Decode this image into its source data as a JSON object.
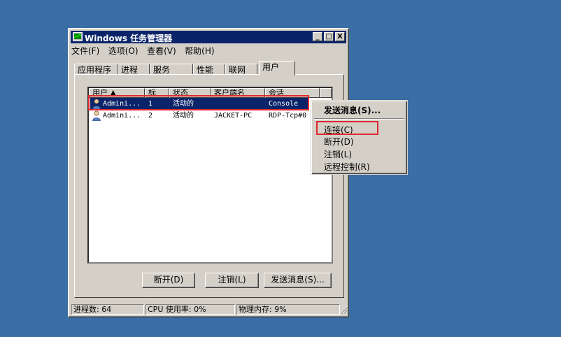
{
  "window": {
    "title": "Windows 任务管理器",
    "controls": {
      "minimize": "_",
      "maximize": "□",
      "close": "X"
    }
  },
  "menubar": {
    "items": [
      "文件(F)",
      "选项(O)",
      "查看(V)",
      "帮助(H)"
    ]
  },
  "tabs": {
    "items": [
      "应用程序",
      "进程",
      "服务",
      "性能",
      "联网",
      "用户"
    ],
    "active": "用户"
  },
  "table": {
    "columns": [
      "用户 ▲",
      "标",
      "状态",
      "客户端名",
      "会话"
    ],
    "rows": [
      {
        "user": "Admini...",
        "id": "1",
        "status": "活动的",
        "client": "",
        "session": "Console",
        "selected": true
      },
      {
        "user": "Admini...",
        "id": "2",
        "status": "活动的",
        "client": "JACKET-PC",
        "session": "RDP-Tcp#0",
        "selected": false
      }
    ]
  },
  "buttons": {
    "disconnect": "断开(D)",
    "logoff": "注销(L)",
    "send_message": "发送消息(S)..."
  },
  "status_bar": {
    "processes": "进程数: 64",
    "cpu": "CPU 使用率: 0%",
    "memory": "物理内存: 9%"
  },
  "context_menu": {
    "items": [
      "发送消息(S)...",
      "连接(C)",
      "断开(D)",
      "注销(L)",
      "远程控制(R)"
    ]
  },
  "colors": {
    "desktop": "#3a6ea5",
    "titlebar": "#0a246a",
    "highlight": "#e0282e"
  }
}
